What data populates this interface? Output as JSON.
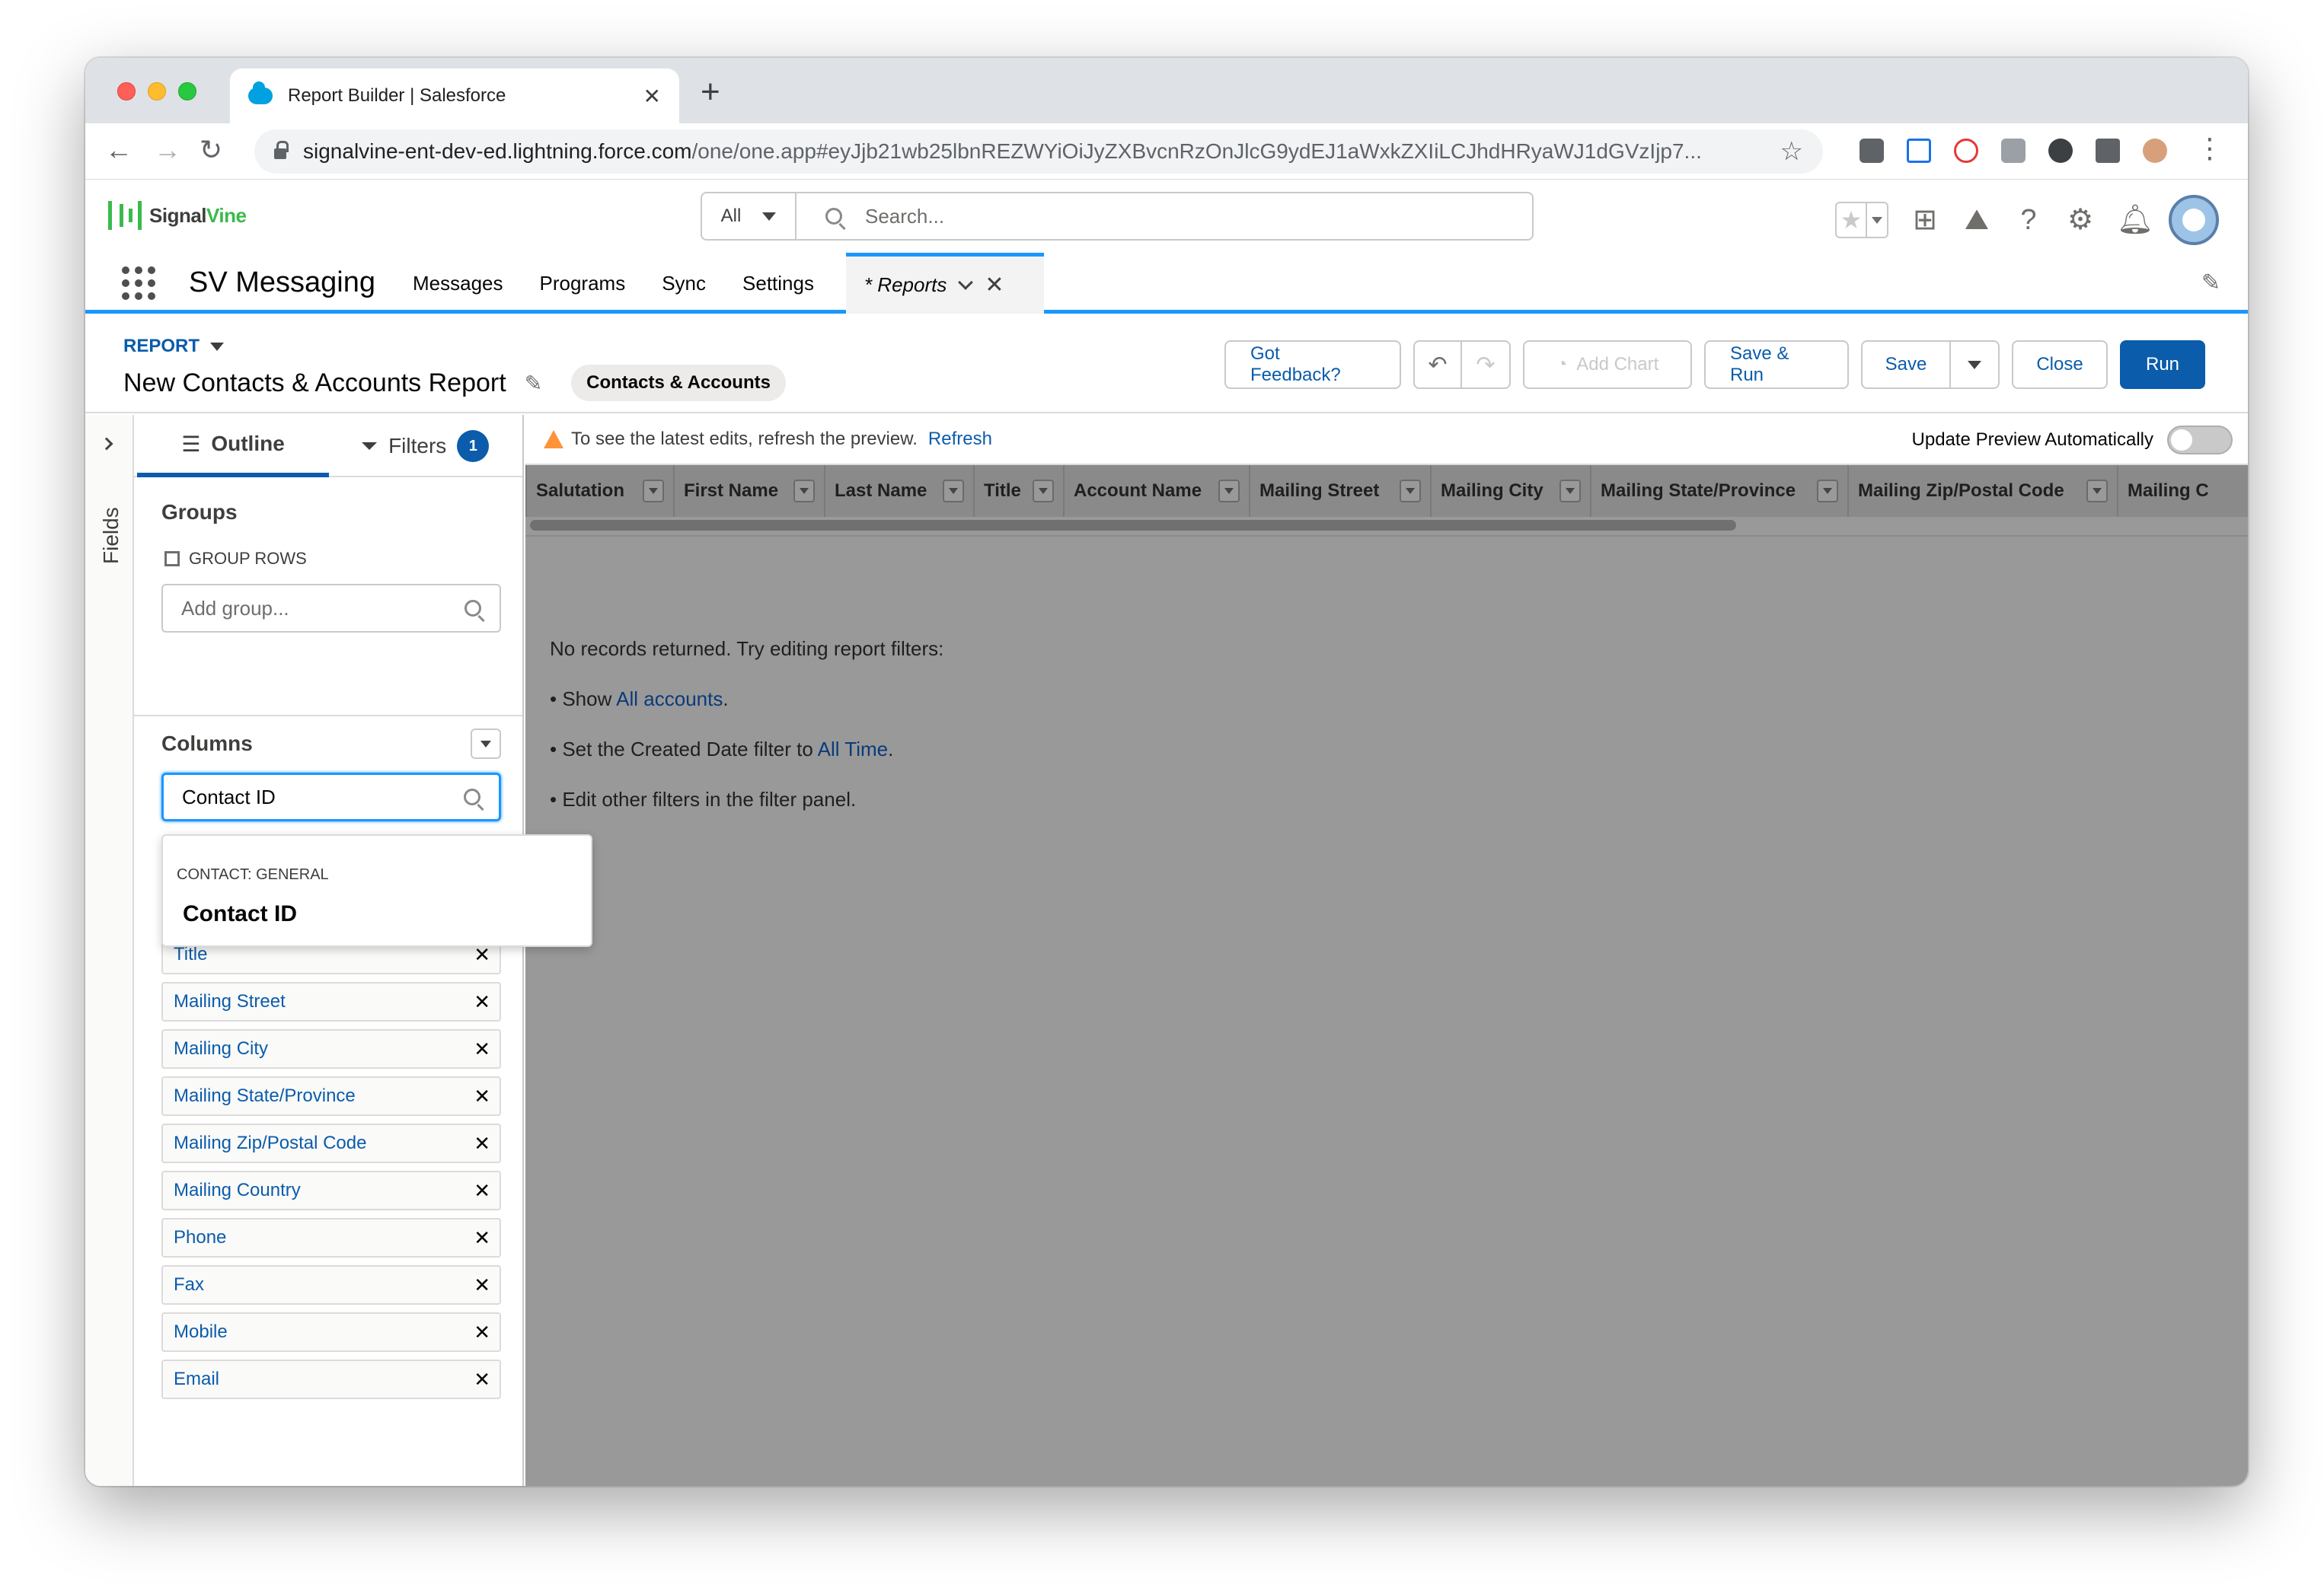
{
  "browser": {
    "tab_title": "Report Builder | Salesforce",
    "url_host": "signalvine-ent-dev-ed.lightning.force.com",
    "url_path": "/one/one.app#eyJjb21wb25lbnREZWYiOiJyZXBvcnRzOnJlcG9ydEJ1aWxkZXIiLCJhdHRyaWJ1dGVzIjp7..."
  },
  "header": {
    "logo_signal": "Signal",
    "logo_vine": "Vine",
    "search_scope": "All",
    "search_placeholder": "Search..."
  },
  "app_nav": {
    "app_name": "SV Messaging",
    "items": [
      "Messages",
      "Programs",
      "Sync",
      "Settings"
    ],
    "active_tab": "* Reports"
  },
  "report_header": {
    "eyebrow": "REPORT",
    "title": "New Contacts & Accounts Report",
    "report_type": "Contacts & Accounts",
    "buttons": {
      "feedback": "Got Feedback?",
      "add_chart": "Add Chart",
      "save_run": "Save & Run",
      "save": "Save",
      "close": "Close",
      "run": "Run"
    }
  },
  "fields_rail": {
    "label": "Fields"
  },
  "panel": {
    "tabs": {
      "outline": "Outline",
      "filters": "Filters",
      "filters_count": "1"
    },
    "groups": {
      "title": "Groups",
      "group_rows": "GROUP ROWS",
      "add_placeholder": "Add group..."
    },
    "columns": {
      "title": "Columns",
      "search_value": "Contact ID",
      "items": [
        "Title",
        "Mailing Street",
        "Mailing City",
        "Mailing State/Province",
        "Mailing Zip/Postal Code",
        "Mailing Country",
        "Phone",
        "Fax",
        "Mobile",
        "Email"
      ]
    },
    "dropdown": {
      "category": "CONTACT: GENERAL",
      "option": "Contact ID"
    }
  },
  "preview": {
    "warning_text": "To see the latest edits, refresh the preview.",
    "refresh_link": "Refresh",
    "auto_update_label": "Update Preview Automatically",
    "column_headers": [
      "Salutation",
      "First Name",
      "Last Name",
      "Title",
      "Account Name",
      "Mailing Street",
      "Mailing City",
      "Mailing State/Province",
      "Mailing Zip/Postal Code",
      "Mailing C"
    ],
    "empty": {
      "line1": "No records returned. Try editing report filters:",
      "line2_prefix": "• Show ",
      "line2_link": "All accounts",
      "line2_suffix": ".",
      "line3_prefix": "• Set the Created Date filter to ",
      "line3_link": "All Time",
      "line3_suffix": ".",
      "line4": "• Edit other filters in the filter panel."
    }
  }
}
